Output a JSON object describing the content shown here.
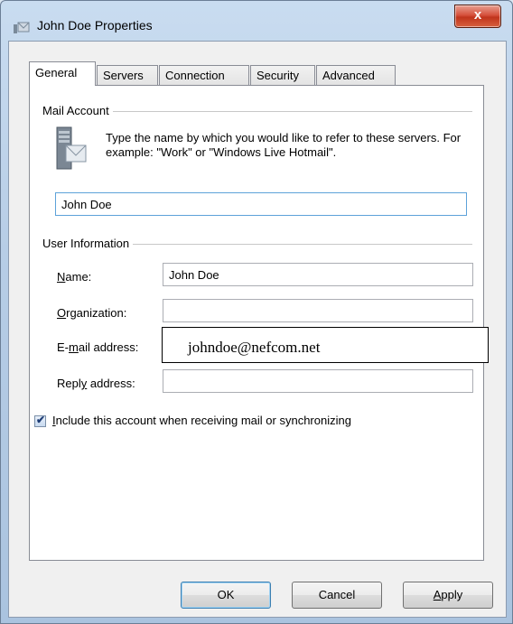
{
  "window": {
    "title": "John Doe Properties",
    "close_label": "x"
  },
  "tabs": [
    {
      "label": "General"
    },
    {
      "label": "Servers"
    },
    {
      "label": "Connection"
    },
    {
      "label": "Security"
    },
    {
      "label": "Advanced"
    }
  ],
  "mail_account": {
    "group_label": "Mail Account",
    "description": "Type the name by which you would like to refer to these servers.  For example: \"Work\" or \"Windows Live Hotmail\".",
    "account_name_value": "John Doe"
  },
  "user_info": {
    "group_label": "User Information",
    "name_label_u": "N",
    "name_label_rest": "ame:",
    "name_value": "John Doe",
    "org_label_u": "O",
    "org_label_rest": "rganization:",
    "org_value": "",
    "email_label_pre": "E-",
    "email_label_u": "m",
    "email_label_rest": "ail address:",
    "email_value": "johndoe@nefcom.net",
    "reply_label_pre": "Repl",
    "reply_label_u": "y",
    "reply_label_rest": " address:",
    "reply_value": ""
  },
  "include_checkbox": {
    "checked": true,
    "label_u": "I",
    "label_rest": "nclude this account when receiving mail or synchronizing"
  },
  "buttons": {
    "ok": "OK",
    "cancel": "Cancel",
    "apply_u": "A",
    "apply_rest": "pply"
  }
}
